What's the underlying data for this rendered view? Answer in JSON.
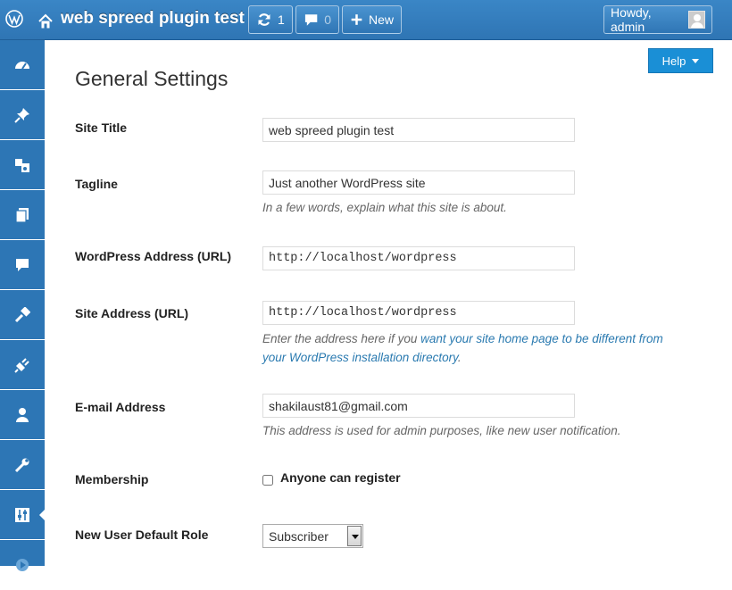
{
  "admin_bar": {
    "site_title": "web spreed plugin test",
    "updates_count": "1",
    "comments_count": "0",
    "new_label": "New",
    "howdy_label": "Howdy, admin"
  },
  "help": {
    "label": "Help"
  },
  "page": {
    "title": "General Settings"
  },
  "settings": {
    "site_title": {
      "label": "Site Title",
      "value": "web spreed plugin test"
    },
    "tagline": {
      "label": "Tagline",
      "value": "Just another WordPress site",
      "description": "In a few words, explain what this site is about."
    },
    "wp_address": {
      "label": "WordPress Address (URL)",
      "value": "http://localhost/wordpress"
    },
    "site_address": {
      "label": "Site Address (URL)",
      "value": "http://localhost/wordpress",
      "description_prefix": "Enter the address here if you ",
      "description_link": "want your site home page to be different from",
      "description_link2": "your WordPress installation directory",
      "description_suffix": "."
    },
    "email": {
      "label": "E-mail Address",
      "value": "shakilaust81@gmail.com",
      "description": "This address is used for admin purposes, like new user notification."
    },
    "membership": {
      "label": "Membership",
      "checkbox_label": "Anyone can register",
      "checked": false
    },
    "default_role": {
      "label": "New User Default Role",
      "selected": "Subscriber"
    }
  },
  "sidebar": {
    "items": [
      {
        "icon": "dashboard-icon"
      },
      {
        "icon": "pin-icon"
      },
      {
        "icon": "media-icon"
      },
      {
        "icon": "pages-icon"
      },
      {
        "icon": "comments-icon"
      },
      {
        "icon": "appearance-icon"
      },
      {
        "icon": "plugins-icon"
      },
      {
        "icon": "users-icon"
      },
      {
        "icon": "tools-icon"
      },
      {
        "icon": "settings-icon"
      },
      {
        "icon": "collapse-icon"
      }
    ]
  },
  "colors": {
    "admin_bar": "#2f75b4",
    "sidebar": "#2d76b5",
    "help_button": "#1a8fd6",
    "link": "#2a7ab0"
  }
}
